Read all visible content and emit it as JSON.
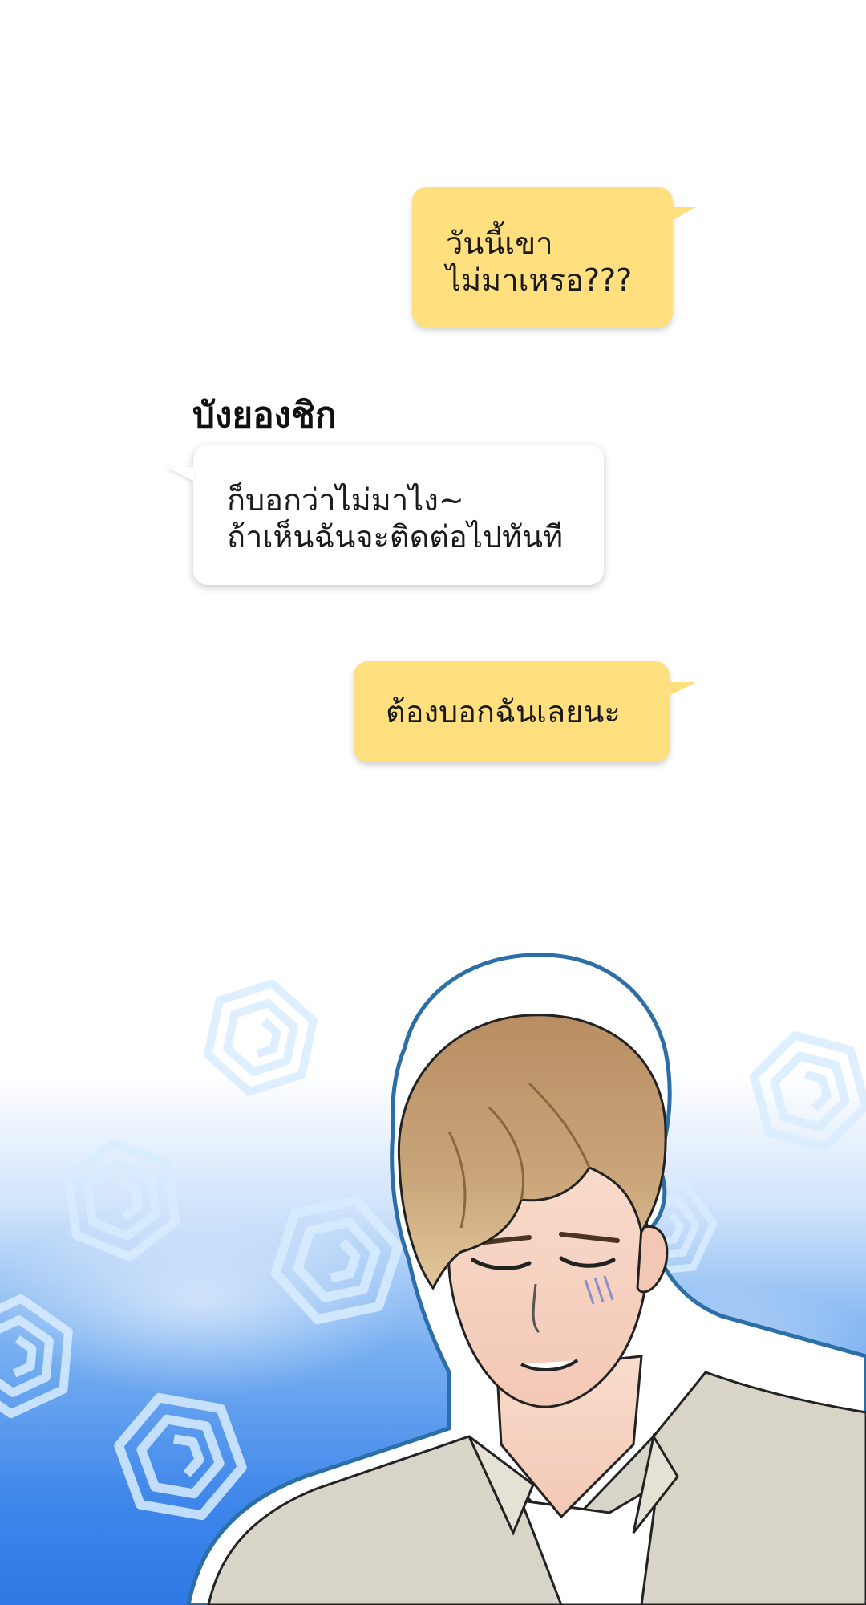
{
  "messages": [
    {
      "sender": "me",
      "lines": [
        "วันนี้เขา",
        "ไม่มาเหรอ???"
      ]
    },
    {
      "sender": "them",
      "speaker": "บังยองชิก",
      "lines": [
        "ก็บอกว่าไม่มาไง~",
        "ถ้าเห็นฉันจะติดต่อไปทันที"
      ]
    },
    {
      "sender": "me",
      "lines": [
        "ต้องบอกฉันเลยนะ"
      ]
    }
  ],
  "colors": {
    "my_bubble": "#ffdf7e",
    "their_bubble": "#ffffff",
    "sky_blue": "#2f79e6",
    "swirl": "#cfe8ff"
  },
  "illustration": {
    "subject": "young-man-eyes-closed",
    "background": "blue-gradient-with-swirl-icons"
  }
}
